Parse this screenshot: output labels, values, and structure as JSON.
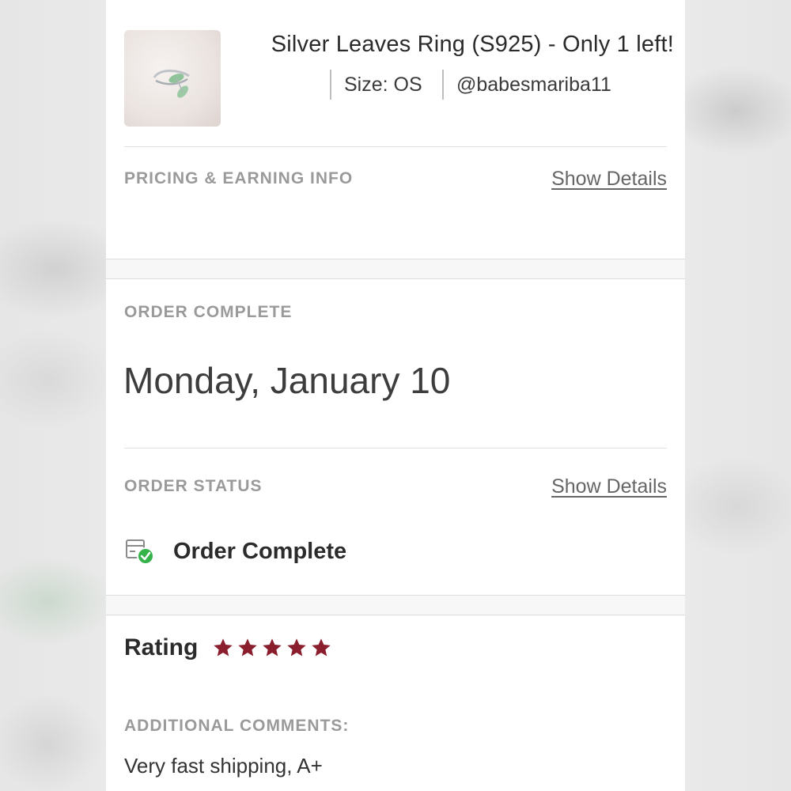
{
  "product": {
    "title": "Silver Leaves Ring (S925) - Only 1 left!",
    "size": "Size: OS",
    "seller": "@babesmariba11",
    "thumbnail_icon": "ring-photo"
  },
  "pricing": {
    "label": "PRICING & EARNING INFO",
    "link": "Show Details"
  },
  "order_complete": {
    "label": "ORDER COMPLETE",
    "date": "Monday, January 10"
  },
  "order_status": {
    "label": "ORDER STATUS",
    "link": "Show Details",
    "status": "Order Complete",
    "status_icon": "package-check-icon",
    "status_color": "#34b34a"
  },
  "rating": {
    "label": "Rating",
    "stars": 5,
    "star_color": "#8b1e2d"
  },
  "comments": {
    "label": "ADDITIONAL COMMENTS:",
    "text": "Very fast shipping, A+"
  }
}
